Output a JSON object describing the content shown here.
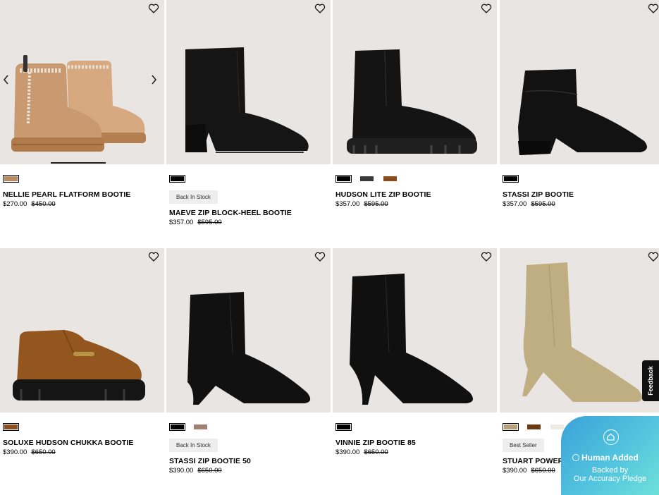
{
  "products": [
    {
      "name": "NELLIE PEARL FLATFORM BOOTIE",
      "price": "$270.00",
      "original_price": "$450.00",
      "badge": "",
      "swatches": [
        "#b98a5e"
      ],
      "has_carousel": true
    },
    {
      "name": "MAEVE ZIP BLOCK-HEEL BOOTIE",
      "price": "$357.00",
      "original_price": "$595.00",
      "badge": "Back In Stock",
      "swatches": [
        "#000000"
      ]
    },
    {
      "name": "HUDSON LITE ZIP BOOTIE",
      "price": "$357.00",
      "original_price": "$595.00",
      "badge": "",
      "swatches": [
        "#000000",
        "#3a3a3a",
        "#8a4a1c"
      ]
    },
    {
      "name": "STASSI ZIP BOOTIE",
      "price": "$357.00",
      "original_price": "$595.00",
      "badge": "",
      "swatches": [
        "#000000"
      ]
    },
    {
      "name": "SOLUXE HUDSON CHUKKA BOOTIE",
      "price": "$390.00",
      "original_price": "$650.00",
      "badge": "",
      "swatches": [
        "#8b5022"
      ]
    },
    {
      "name": "STASSI ZIP BOOTIE 50",
      "price": "$390.00",
      "original_price": "$650.00",
      "badge": "Back In Stock",
      "swatches": [
        "#000000",
        "#a08070"
      ]
    },
    {
      "name": "VINNIE ZIP BOOTIE 85",
      "price": "$390.00",
      "original_price": "$650.00",
      "badge": "",
      "swatches": [
        "#000000"
      ]
    },
    {
      "name": "STUART POWER BOOTIE 75",
      "price": "$390.00",
      "original_price": "$650.00",
      "badge": "Best Seller",
      "swatches": [
        "#b8a07a",
        "#6b3a12",
        "#eeeae4",
        "#1a1a1a",
        "#1f7d8c"
      ]
    }
  ],
  "feedback_tab": {
    "label": "Feedback"
  },
  "accuracy_pledge": {
    "title": "Human Added",
    "line2": "Backed by",
    "line3": "Our Accuracy Pledge"
  },
  "colors": {
    "image_background": "#e8e5e2",
    "badge_background": "#eeeeee",
    "pledge_gradient_start": "#3ba2d9",
    "pledge_gradient_end": "#6ee0da"
  }
}
